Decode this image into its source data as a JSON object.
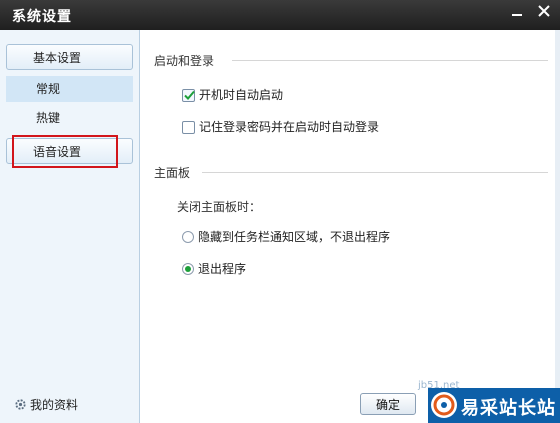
{
  "window": {
    "title": "系统设置"
  },
  "sidebar": {
    "items": [
      {
        "label": "基本设置"
      },
      {
        "label": "常规"
      },
      {
        "label": "热键"
      },
      {
        "label": "语音设置"
      }
    ],
    "profile_label": "我的资料"
  },
  "main": {
    "startup_section": {
      "title": "启动和登录",
      "options": [
        {
          "label": "开机时自动启动",
          "checked": true
        },
        {
          "label": "记住登录密码并在启动时自动登录",
          "checked": false
        }
      ]
    },
    "panel_section": {
      "title": "主面板",
      "prompt": "关闭主面板时：",
      "options": [
        {
          "label": "隐藏到任务栏通知区域，不退出程序",
          "selected": false
        },
        {
          "label": "退出程序",
          "selected": true
        }
      ]
    }
  },
  "footer": {
    "ok_label": "确定"
  },
  "watermark": {
    "brand": "易采站长站",
    "url": "jb51.net"
  }
}
